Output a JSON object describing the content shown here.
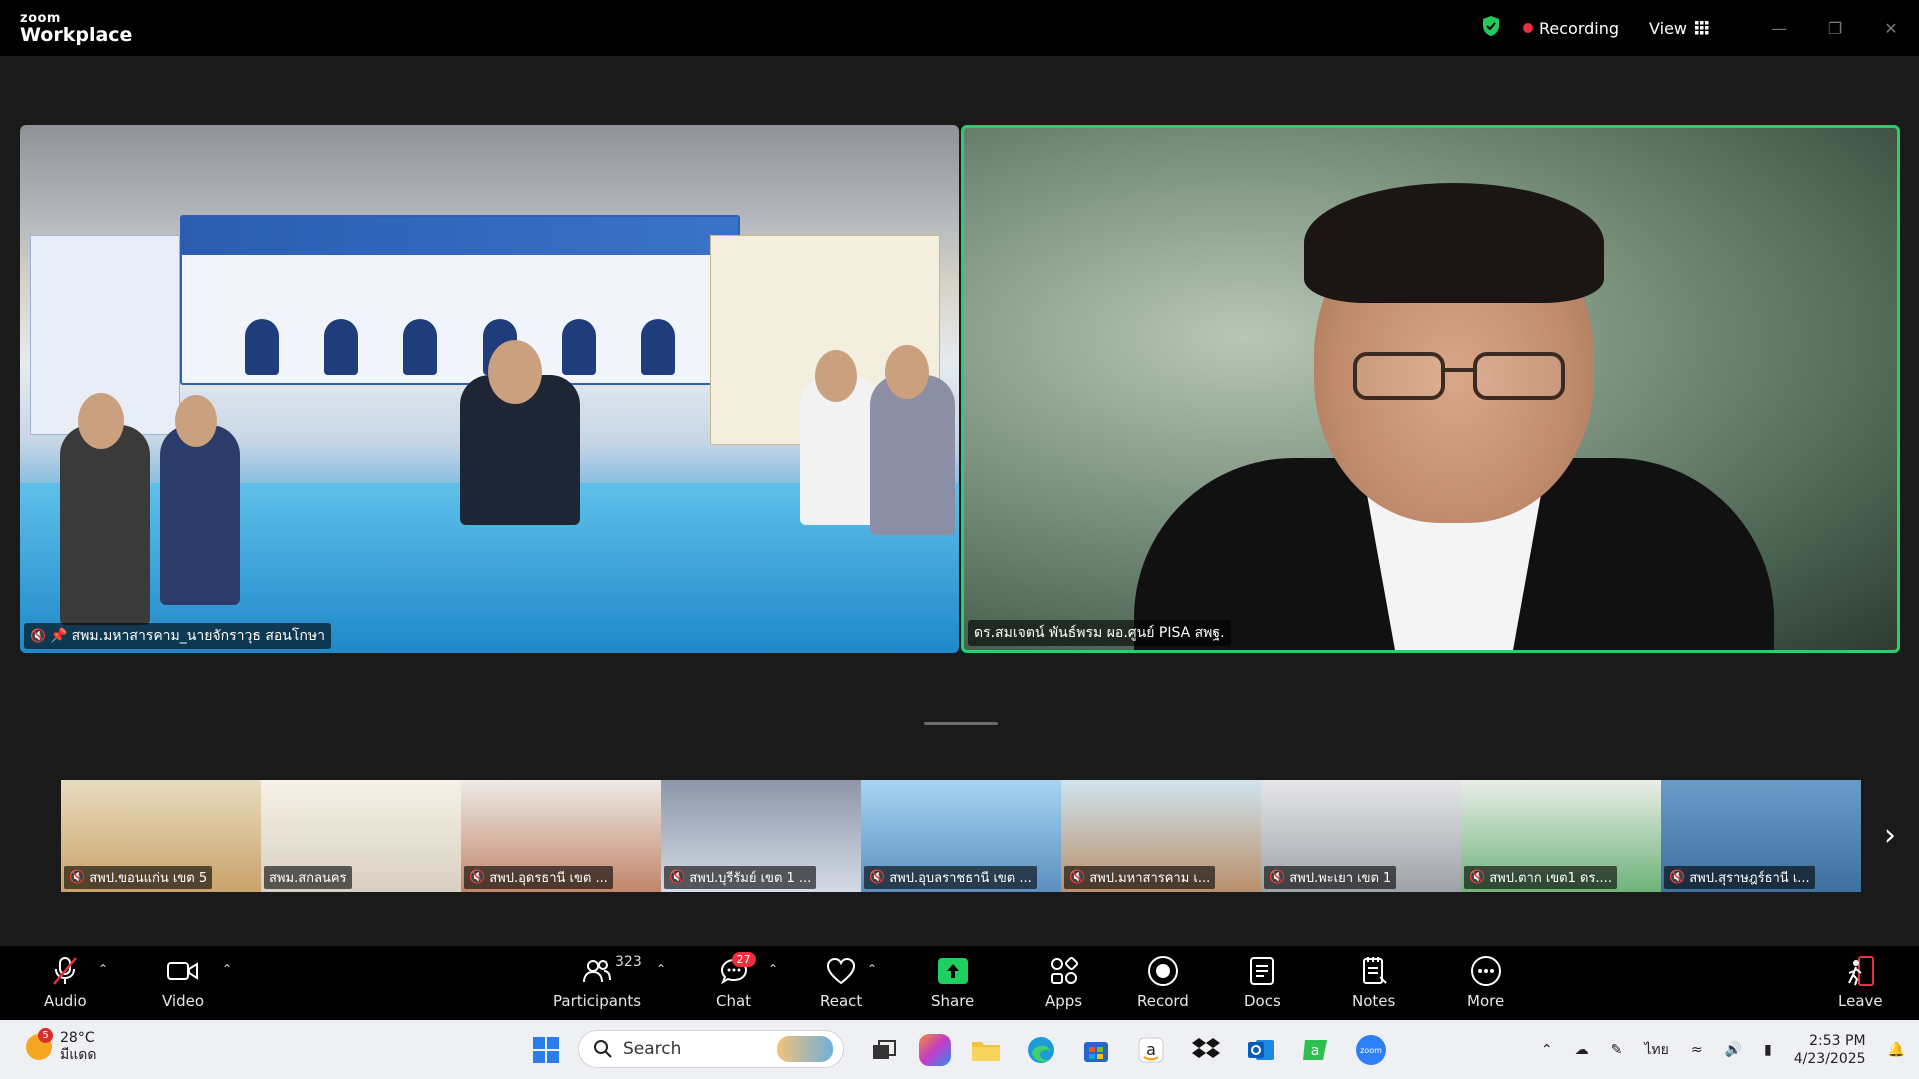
{
  "app": {
    "brand_small": "zoom",
    "brand_big": "Workplace",
    "recording": "Recording",
    "view": "View"
  },
  "main_videos": [
    {
      "name": "สพม.มหาสารคาม_นายจักราวุธ สอนโกษา"
    },
    {
      "name": "ดร.สมเจตน์ พันธ์พรม ผอ.ศูนย์ PISA สพฐ."
    }
  ],
  "thumbnails": [
    {
      "name": "สพป.ขอนแก่น เขต 5",
      "color": "#c9a36a"
    },
    {
      "name": "สพม.สกลนคร",
      "color": "#e8e2d8"
    },
    {
      "name": "สพป.อุดรธานี เขต ...",
      "color": "#d9d6d2"
    },
    {
      "name": "สพป.บุรีรัมย์ เขต 1 ...",
      "color": "#7b8aa8"
    },
    {
      "name": "สพป.อุบลราชธานี เขต ...",
      "color": "#6fa9d8"
    },
    {
      "name": "สพป.มหาสารคาม เ...",
      "color": "#8fb6c9"
    },
    {
      "name": "สพป.พะเยา เขต 1",
      "color": "#c7c9cc"
    },
    {
      "name": "สพป.ตาก เขต1 ดร....",
      "color": "#6fb27a"
    },
    {
      "name": "สพป.สุราษฎร์ธานี เ...",
      "color": "#4c7fae"
    }
  ],
  "toolbar": {
    "audio": "Audio",
    "video": "Video",
    "participants": "Participants",
    "participants_count": "323",
    "chat": "Chat",
    "chat_badge": "27",
    "react": "React",
    "share": "Share",
    "apps": "Apps",
    "record": "Record",
    "docs": "Docs",
    "notes": "Notes",
    "more": "More",
    "leave": "Leave"
  },
  "taskbar": {
    "weather_temp": "28°C",
    "weather_desc": "มีแดด",
    "weather_badge": "5",
    "search": "Search",
    "lang": "ไทย",
    "time": "2:53 PM",
    "date": "4/23/2025"
  },
  "colors": {
    "active_speaker": "#2ecc71",
    "recording": "#e9303f",
    "share": "#1fcf5f"
  }
}
